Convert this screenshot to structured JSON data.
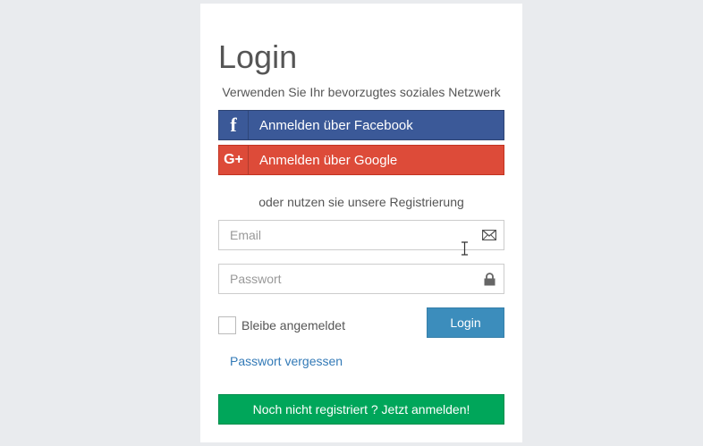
{
  "login": {
    "title": "Login",
    "subtitle": "Verwenden Sie Ihr bevorzugtes soziales Netzwerk",
    "facebook_label": "Anmelden über Facebook",
    "facebook_icon": "f",
    "google_label": "Anmelden über Google",
    "google_icon": "G+",
    "or_text": "oder nutzen sie unsere Registrierung",
    "email_placeholder": "Email",
    "email_value": "",
    "password_placeholder": "Passwort",
    "password_value": "",
    "remember_label": "Bleibe angemeldet",
    "remember_checked": false,
    "login_button": "Login",
    "forgot_link": "Passwort vergessen",
    "register_button": "Noch nicht registriert ? Jetzt anmelden!"
  },
  "colors": {
    "facebook": "#3b5998",
    "google": "#dd4b39",
    "primary": "#3c8dbc",
    "success": "#00a65a",
    "link": "#337ab7",
    "background": "#e9ebee"
  },
  "icons": {
    "email_field": "envelope-icon",
    "password_field": "lock-icon"
  }
}
